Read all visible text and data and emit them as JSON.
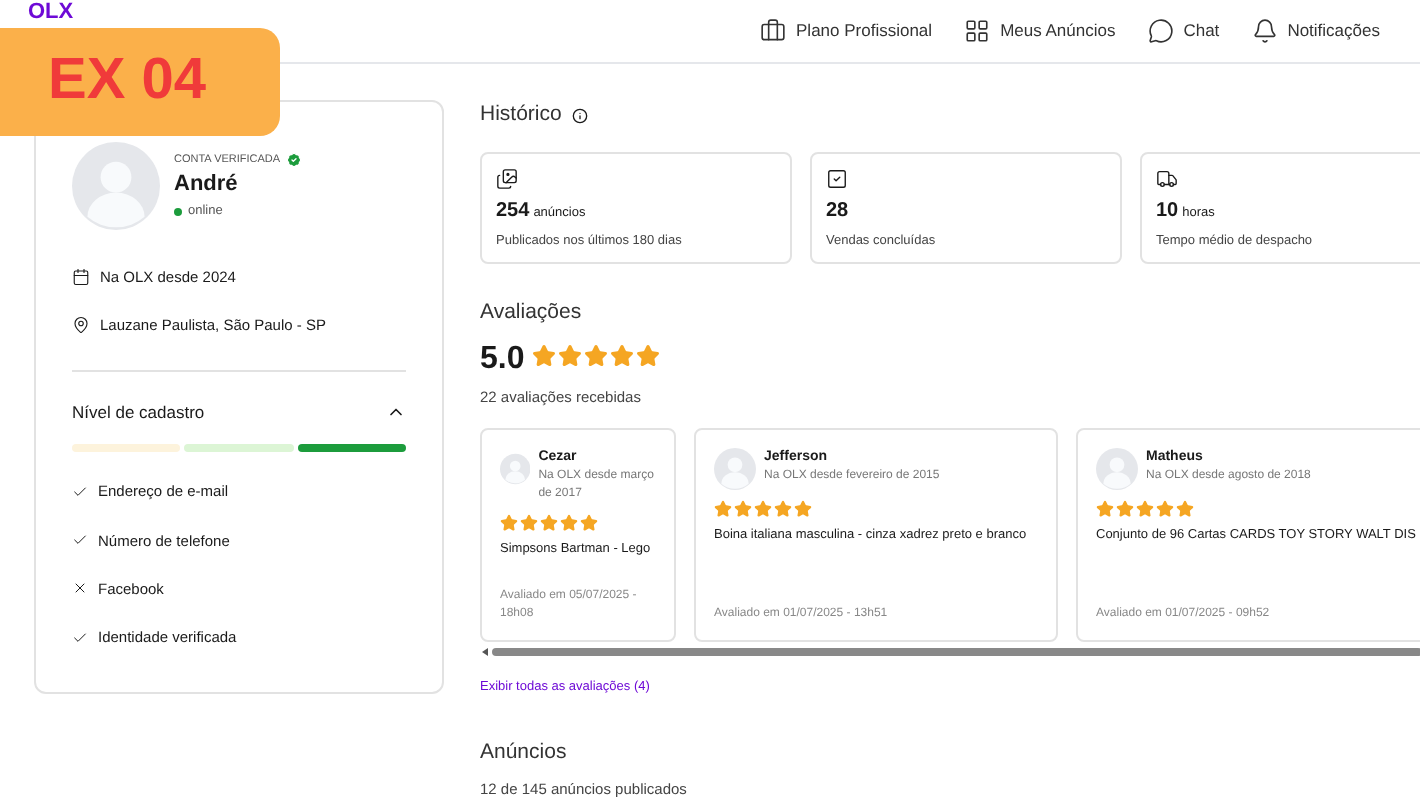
{
  "logo": "OLX",
  "banner": {
    "text": "EX 04"
  },
  "nav": [
    {
      "label": "Plano Profissional"
    },
    {
      "label": "Meus Anúncios"
    },
    {
      "label": "Chat"
    },
    {
      "label": "Notificações"
    }
  ],
  "profile": {
    "badge": "CONTA VERIFICADA",
    "name": "André",
    "status": "online",
    "online": true,
    "since": "Na OLX desde 2024",
    "location": "Lauzane Paulista, São Paulo - SP"
  },
  "registration": {
    "title": "Nível de cadastro",
    "expanded": true,
    "segments": [
      {
        "color": "#fdf3dc"
      },
      {
        "color": "#dcf5d5"
      },
      {
        "color": "#1c9c3c"
      }
    ],
    "items": [
      {
        "label": "Endereço de e-mail",
        "checked": true
      },
      {
        "label": "Número de telefone",
        "checked": true
      },
      {
        "label": "Facebook",
        "checked": false
      },
      {
        "label": "Identidade verificada",
        "checked": true
      }
    ]
  },
  "history": {
    "title": "Histórico",
    "stats": [
      {
        "value": "254",
        "unit": "anúncios",
        "caption": "Publicados nos últimos 180 dias"
      },
      {
        "value": "28",
        "caption": "Vendas concluídas"
      },
      {
        "value": "10",
        "unit": "horas",
        "caption": "Tempo médio de despacho"
      }
    ]
  },
  "reviews": {
    "title": "Avaliações",
    "score": "5.0",
    "stars": 5,
    "count": "22 avaliações recebidas",
    "items": [
      {
        "name": "Cezar",
        "since": "Na OLX desde março de 2017",
        "stars": 5,
        "product": "Simpsons Bartman - Lego",
        "date": "Avaliado em 05/07/2025 - 18h08"
      },
      {
        "name": "Jefferson",
        "since": "Na OLX desde fevereiro de 2015",
        "stars": 5,
        "product": "Boina italiana masculina - cinza xadrez preto e branco",
        "date": "Avaliado em 01/07/2025 - 13h51"
      },
      {
        "name": "Matheus",
        "since": "Na OLX desde agosto de 2018",
        "stars": 5,
        "product": "Conjunto de 96 Cartas CARDS TOY STORY WALT DIS",
        "date": "Avaliado em 01/07/2025 - 09h52"
      }
    ],
    "link": "Exibir todas as avaliações (4)"
  },
  "listings": {
    "title": "Anúncios",
    "count": "12 de 145 anúncios publicados"
  }
}
